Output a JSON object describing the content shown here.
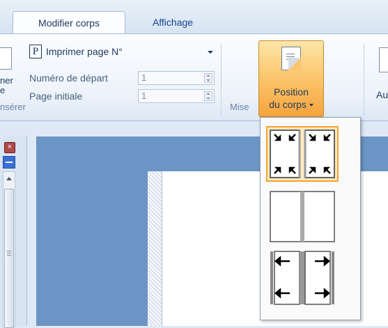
{
  "tabs": [
    {
      "label": "Modifier corps",
      "active": true
    },
    {
      "label": "Affichage",
      "active": false
    }
  ],
  "left_partial": {
    "label_line1": "ner",
    "label_line2": "e",
    "group": "nsérer"
  },
  "insert_group": {
    "print_page": {
      "label": "Imprimer page N°",
      "icon": "P"
    },
    "start_number": {
      "label": "Numéro de départ",
      "value": "1"
    },
    "initial_page": {
      "label": "Page initiale",
      "value": "1"
    }
  },
  "mise_group": {
    "group_label": "Mise",
    "position_button": {
      "line1": "Position",
      "line2": "du corps"
    }
  },
  "right_partial": {
    "label": "Au"
  },
  "dropdown": {
    "options": [
      {
        "name": "corners-arrows",
        "selected": true
      },
      {
        "name": "split-pages",
        "selected": false
      },
      {
        "name": "side-arrows",
        "selected": false
      }
    ]
  },
  "colors": {
    "accent_orange": "#f6a33d",
    "workspace_blue": "#6b95c4",
    "ribbon_text": "#1e395b"
  }
}
